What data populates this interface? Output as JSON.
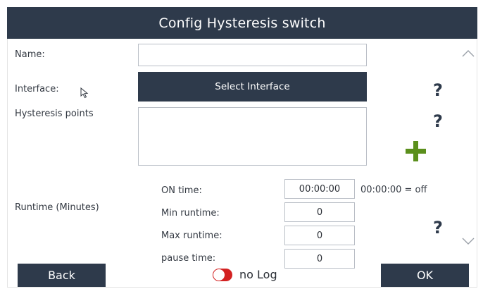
{
  "window": {
    "title": "Config Hysteresis switch"
  },
  "form": {
    "name_label": "Name:",
    "name_value": "",
    "interface_label": "Interface:",
    "interface_button": "Select Interface",
    "hysteresis_label": "Hysteresis points",
    "hysteresis_value": "",
    "runtime_label": "Runtime (Minutes)",
    "on_time_label": "ON time:",
    "on_time_value": "00:00:00",
    "on_time_hint": "00:00:00 = off",
    "min_runtime_label": "Min runtime:",
    "min_runtime_value": "0",
    "max_runtime_label": "Max runtime:",
    "max_runtime_value": "0",
    "pause_time_label": "pause time:",
    "pause_time_value": "0"
  },
  "help": {
    "symbol": "?"
  },
  "footer": {
    "back_label": "Back",
    "log_label": "no Log",
    "log_on": false,
    "ok_label": "OK"
  },
  "icons": {
    "add": "plus-icon",
    "scroll_up": "chevron-up-icon",
    "scroll_down": "chevron-down-icon",
    "cursor": "mouse-pointer-icon",
    "help": "help-icon"
  },
  "colors": {
    "titlebar": "#2e3a4b",
    "button": "#2e3a4b",
    "add_icon": "#5b8f1c",
    "toggle_off": "#d32222"
  }
}
